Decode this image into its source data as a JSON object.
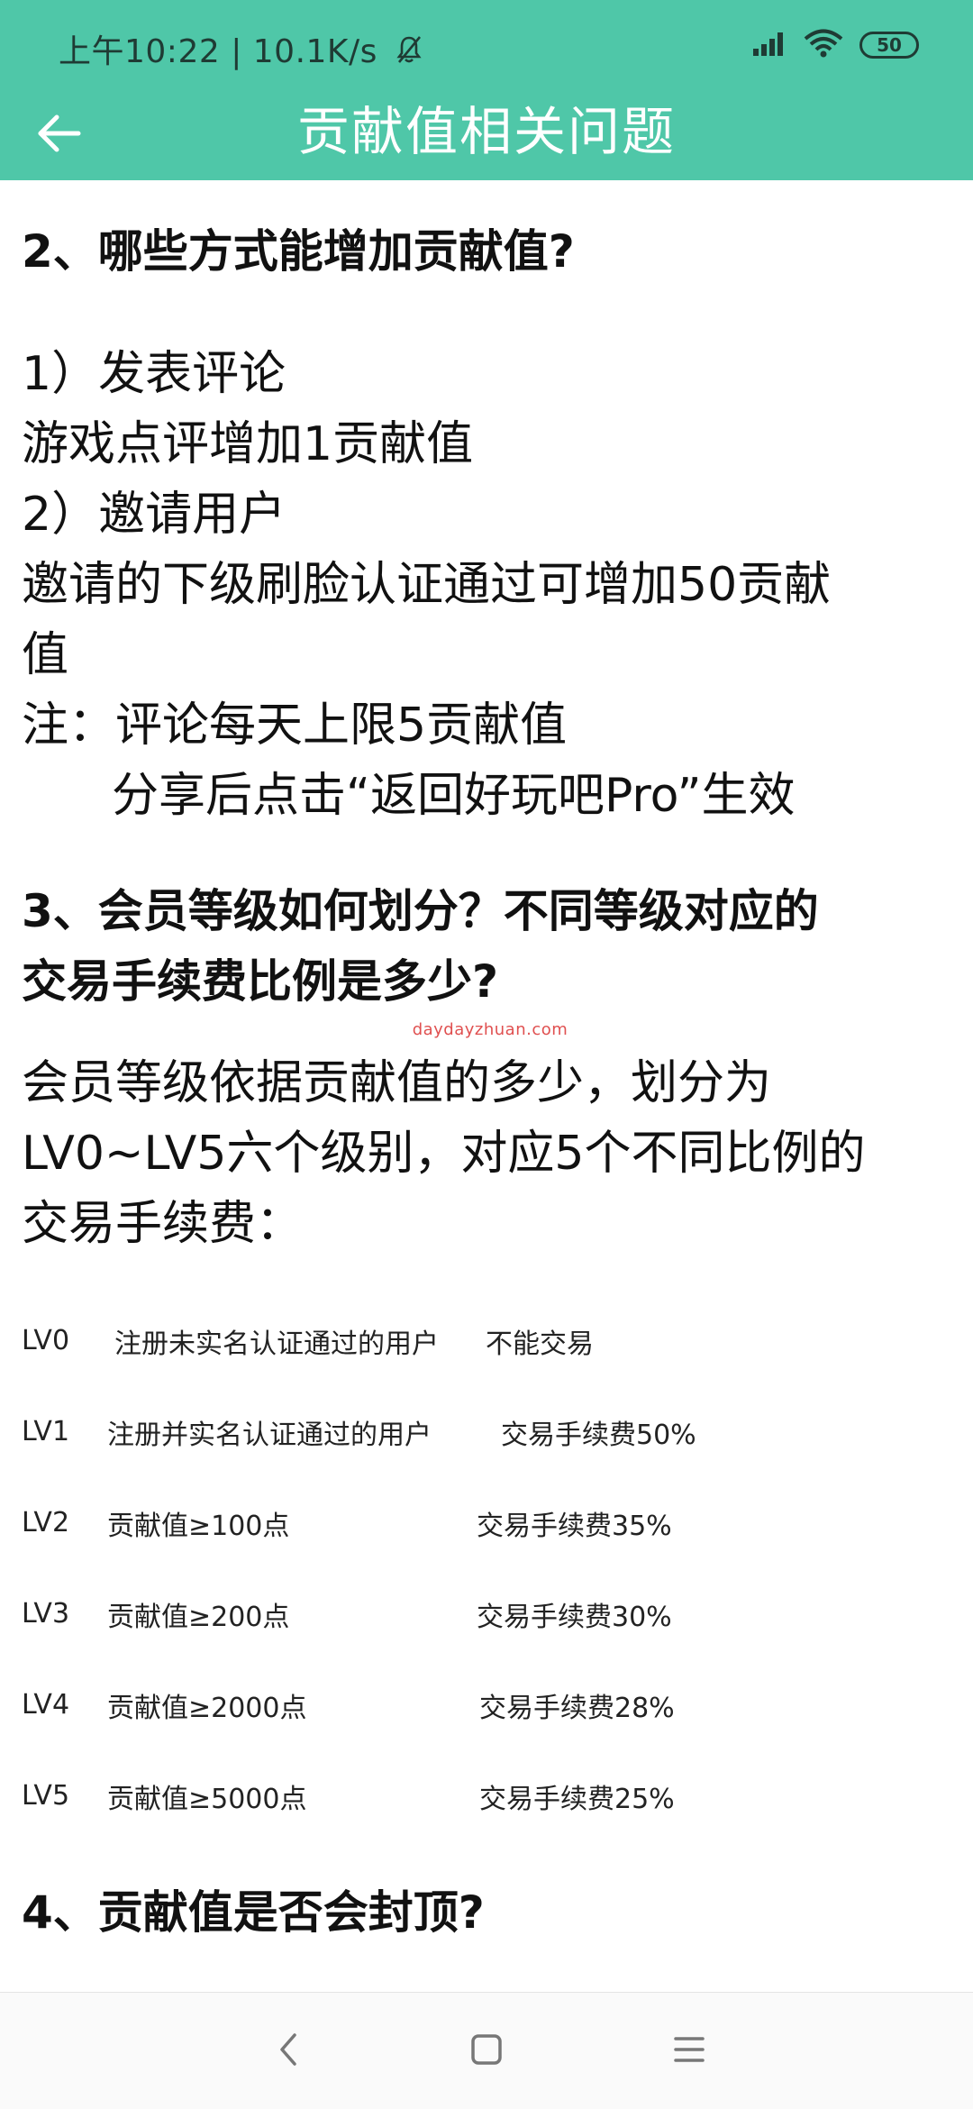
{
  "status_bar": {
    "time_speed": "上午10:22 | 10.1K/s",
    "battery": "50"
  },
  "header": {
    "title": "贡献值相关问题"
  },
  "content": {
    "q2_title": "2、哪些方式能增加贡献值?",
    "q2_lines": [
      "1）发表评论",
      "游戏点评增加1贡献值",
      "2）邀请用户",
      "邀请的下级刷脸认证通过可增加50贡献",
      "值",
      "注：评论每天上限5贡献值",
      "分享后点击“返回好玩吧Pro”生效"
    ],
    "q3_title_line1": "3、会员等级如何划分？不同等级对应的",
    "q3_title_line2": "交易手续费比例是多少?",
    "watermark": "daydayzhuan.com",
    "q3_lines": [
      "会员等级依据贡献值的多少，划分为",
      "LV0~LV5六个级别，对应5个不同比例的",
      "交易手续费："
    ],
    "levels": [
      {
        "name": "LV0",
        "desc": "注册未实名认证通过的用户",
        "fee": "不能交易"
      },
      {
        "name": "LV1",
        "desc": "注册并实名认证通过的用户",
        "fee": "交易手续费50%"
      },
      {
        "name": "LV2",
        "desc": "贡献值≥100点",
        "fee": "交易手续费35%"
      },
      {
        "name": "LV3",
        "desc": "贡献值≥200点",
        "fee": "交易手续费30%"
      },
      {
        "name": "LV4",
        "desc": "贡献值≥2000点",
        "fee": "交易手续费28%"
      },
      {
        "name": "LV5",
        "desc": "贡献值≥5000点",
        "fee": "交易手续费25%"
      }
    ],
    "q4_title": "4、贡献值是否会封顶?"
  },
  "icons": {
    "back": "arrow-left-icon",
    "mute": "bell-off-icon",
    "signal": "signal-icon",
    "wifi": "wifi-icon",
    "battery": "battery-icon",
    "nav_back": "chevron-left-icon",
    "nav_home": "square-icon",
    "nav_menu": "menu-icon"
  },
  "colors": {
    "header_bg": "#4fc7a8",
    "title_text": "#ffffff",
    "watermark": "#e05050"
  }
}
